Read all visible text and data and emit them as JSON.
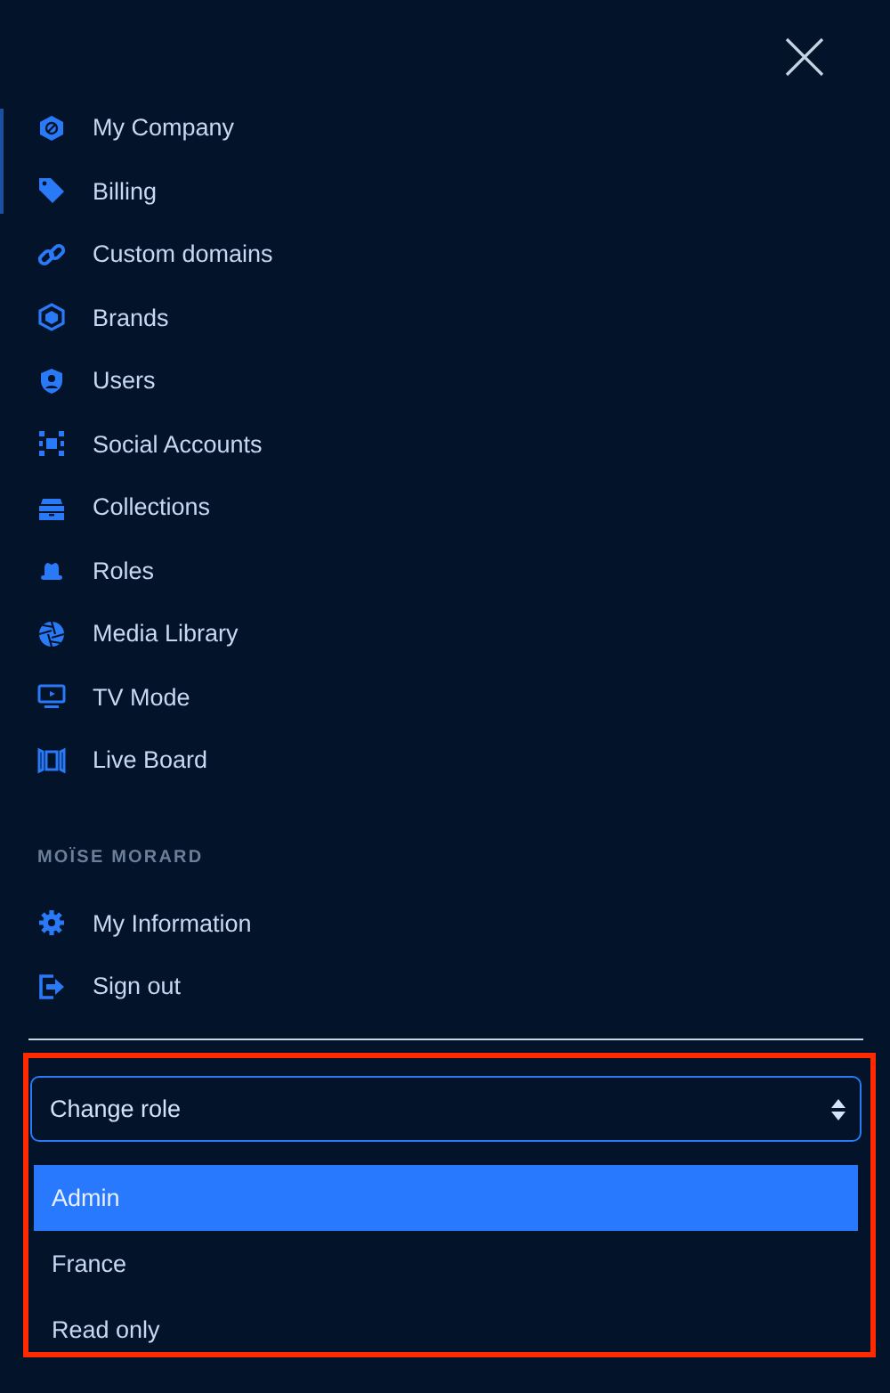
{
  "menu_items": [
    {
      "label": "My Company"
    },
    {
      "label": "Billing"
    },
    {
      "label": "Custom domains"
    },
    {
      "label": "Brands"
    },
    {
      "label": "Users"
    },
    {
      "label": "Social Accounts"
    },
    {
      "label": "Collections"
    },
    {
      "label": "Roles"
    },
    {
      "label": "Media Library"
    },
    {
      "label": "TV Mode"
    },
    {
      "label": "Live Board"
    }
  ],
  "user_section": {
    "title": "MOÏSE MORARD",
    "items": [
      {
        "label": "My Information"
      },
      {
        "label": "Sign out"
      }
    ]
  },
  "role_select": {
    "label": "Change role",
    "options": [
      {
        "label": "Admin",
        "selected": true
      },
      {
        "label": "France",
        "selected": false
      },
      {
        "label": "Read only",
        "selected": false
      }
    ]
  }
}
